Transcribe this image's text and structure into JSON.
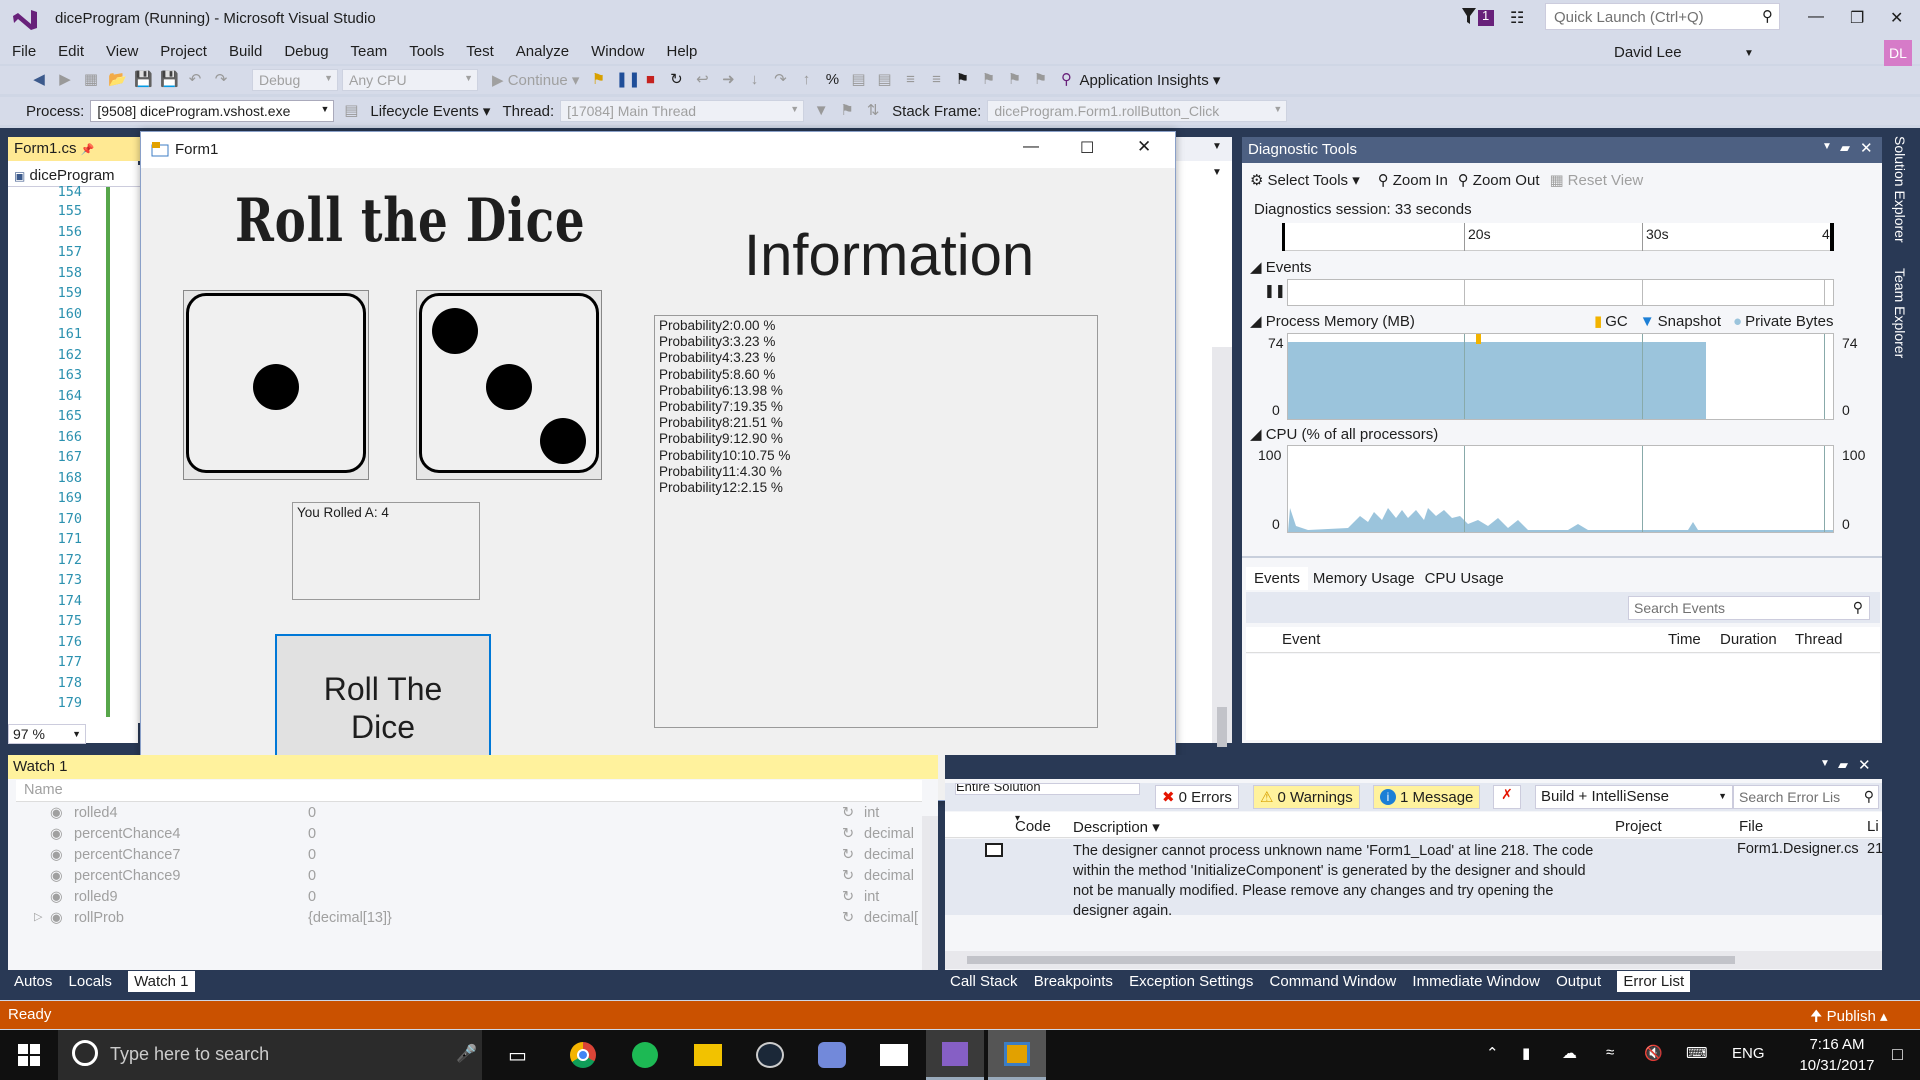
{
  "window": {
    "title": "diceProgram (Running) - Microsoft Visual Studio",
    "notification_count": "1",
    "quick_launch": "Quick Launch (Ctrl+Q)",
    "user": "David Lee",
    "user_initials": "DL"
  },
  "menu": [
    "File",
    "Edit",
    "View",
    "Project",
    "Build",
    "Debug",
    "Team",
    "Tools",
    "Test",
    "Analyze",
    "Window",
    "Help"
  ],
  "toolbar": {
    "config": "Debug",
    "platform": "Any CPU",
    "continue": "Continue",
    "app_insights": "Application Insights"
  },
  "debug_location": {
    "process_label": "Process:",
    "process": "[9508] diceProgram.vshost.exe",
    "lifecycle": "Lifecycle Events",
    "thread_label": "Thread:",
    "thread": "[17084] Main Thread",
    "stack_label": "Stack Frame:",
    "stack": "diceProgram.Form1.rollButton_Click"
  },
  "editor": {
    "tab": "Form1.cs",
    "combo": "diceProgram",
    "zoom": "97 %",
    "lines": [
      "154",
      "155",
      "156",
      "157",
      "158",
      "159",
      "160",
      "161",
      "162",
      "163",
      "164",
      "165",
      "166",
      "167",
      "168",
      "169",
      "170",
      "171",
      "172",
      "173",
      "174",
      "175",
      "176",
      "177",
      "178",
      "179"
    ]
  },
  "form1": {
    "title": "Form1",
    "heading": "Roll the Dice",
    "info_heading": "Information",
    "result": "You Rolled A: 4",
    "roll_button": "Roll The Dice",
    "probabilities": [
      "Probability2:0.00 %",
      "Probability3:3.23 %",
      "Probability4:3.23 %",
      "Probability5:8.60 %",
      "Probability6:13.98 %",
      "Probability7:19.35 %",
      "Probability8:21.51 %",
      "Probability9:12.90 %",
      "Probability10:10.75 %",
      "Probability11:4.30 %",
      "Probability12:2.15 %"
    ],
    "die1_value": 1,
    "die2_value": 3
  },
  "diagnostics": {
    "title": "Diagnostic Tools",
    "select_tools": "Select Tools",
    "zoom_in": "Zoom In",
    "zoom_out": "Zoom Out",
    "reset_view": "Reset View",
    "session": "Diagnostics session: 33 seconds",
    "ticks": [
      "20s",
      "30s",
      "4"
    ],
    "events_label": "Events",
    "memory_label": "Process Memory (MB)",
    "gc": "GC",
    "snapshot": "Snapshot",
    "private_bytes": "Private Bytes",
    "mem_max": "74",
    "mem_min": "0",
    "cpu_label": "CPU (% of all processors)",
    "cpu_max": "100",
    "cpu_min": "0",
    "tabs": [
      "Events",
      "Memory Usage",
      "CPU Usage"
    ],
    "search": "Search Events",
    "columns": [
      "Event",
      "Time",
      "Duration",
      "Thread"
    ]
  },
  "watch": {
    "title": "Watch 1",
    "name_header": "Name",
    "rows": [
      {
        "name": "rolled4",
        "value": "0",
        "type": "int"
      },
      {
        "name": "percentChance4",
        "value": "0",
        "type": "decimal"
      },
      {
        "name": "percentChance7",
        "value": "0",
        "type": "decimal"
      },
      {
        "name": "percentChance9",
        "value": "0",
        "type": "decimal"
      },
      {
        "name": "rolled9",
        "value": "0",
        "type": "int"
      },
      {
        "name": "rollProb",
        "value": "{decimal[13]}",
        "type": "decimal["
      }
    ],
    "tabs": [
      "Autos",
      "Locals",
      "Watch 1"
    ]
  },
  "errors": {
    "scope": "Entire Solution",
    "errors": "0 Errors",
    "warnings": "0 Warnings",
    "messages": "1 Message",
    "build": "Build + IntelliSense",
    "search": "Search Error Lis",
    "columns": [
      "Code",
      "Description",
      "Project",
      "File",
      "Li"
    ],
    "message": "The designer cannot process unknown name 'Form1_Load' at line 218.  The code within the method 'InitializeComponent' is generated by the designer and should not be manually modified.  Please remove any changes and try opening the designer again.",
    "file": "Form1.Designer.cs",
    "line": "21",
    "tabs": [
      "Call Stack",
      "Breakpoints",
      "Exception Settings",
      "Command Window",
      "Immediate Window",
      "Output",
      "Error List"
    ]
  },
  "rail": [
    "Solution Explorer",
    "Team Explorer"
  ],
  "status": {
    "text": "Ready",
    "publish": "Publish"
  },
  "taskbar": {
    "search": "Type here to search",
    "lang": "ENG",
    "time": "7:16 AM",
    "date": "10/31/2017"
  },
  "colors": {
    "accent": "#0078d7",
    "status": "#ca5100",
    "memory": "#9bc4dc"
  }
}
